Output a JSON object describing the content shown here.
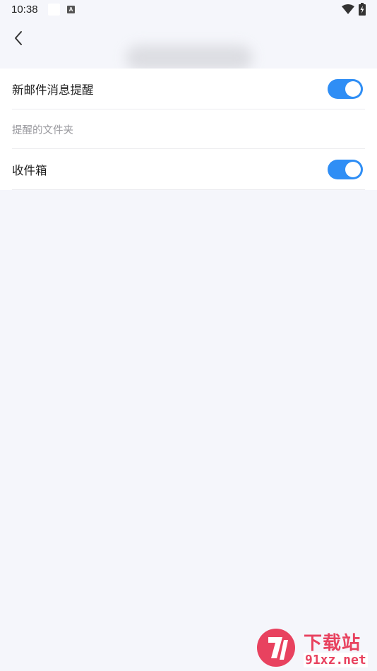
{
  "status_bar": {
    "time": "10:38",
    "notification_badge": "A",
    "icons": [
      "wifi-icon",
      "battery-charging-icon"
    ]
  },
  "header": {
    "back_icon": "chevron-left-icon",
    "title": ""
  },
  "settings": {
    "new_mail_alert": {
      "label": "新邮件消息提醒",
      "enabled": true
    },
    "section_label": "提醒的文件夹",
    "inbox": {
      "label": "收件箱",
      "enabled": true
    }
  },
  "watermark": {
    "top_text": "下载站",
    "bottom_text": "91xz.net"
  },
  "colors": {
    "accent": "#2f8ef5",
    "background": "#f5f6fb",
    "watermark": "#e8425f"
  }
}
